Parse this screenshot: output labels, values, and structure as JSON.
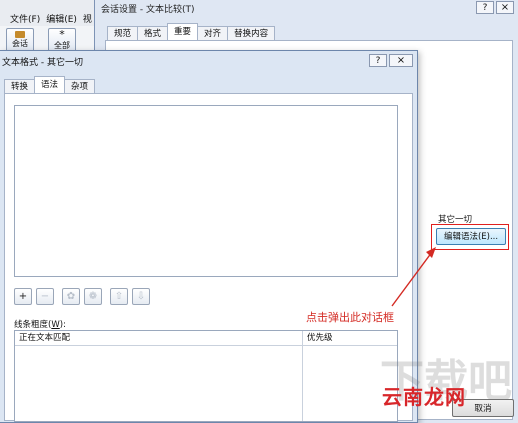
{
  "background_app": {
    "menu": [
      "文件(F)",
      "编辑(E)",
      "视"
    ],
    "toolbar": [
      "会话",
      "全部"
    ]
  },
  "back_dialog": {
    "title": "会话设置 - 文本比较(T)",
    "help_label": "?",
    "close_label": "×",
    "tabs": [
      "规范",
      "格式",
      "重要",
      "对齐",
      "替换内容"
    ],
    "active_tab": "重要",
    "group_label": "其它一切",
    "edit_syntax_button": "编辑语法(E)...",
    "cancel_button": "取消"
  },
  "front_dialog": {
    "title": "文本格式 - 其它一切",
    "help_label": "?",
    "close_label": "×",
    "tabs": [
      "转换",
      "语法",
      "杂项"
    ],
    "active_tab": "语法",
    "toolbar": {
      "add": "+",
      "remove": "−",
      "settings": "✿",
      "group": "❁",
      "up": "⇧",
      "down": "⇩"
    },
    "thickness_label": "线条粗度(",
    "thickness_key": "W",
    "thickness_suffix": "):",
    "list_columns": [
      "正在文本匹配",
      "优先级"
    ]
  },
  "annotation": {
    "callout": "点击弹出此对话框",
    "watermark": "云南龙网",
    "watermark_bg": "下载吧",
    "highlight_color": "#e0201e"
  }
}
